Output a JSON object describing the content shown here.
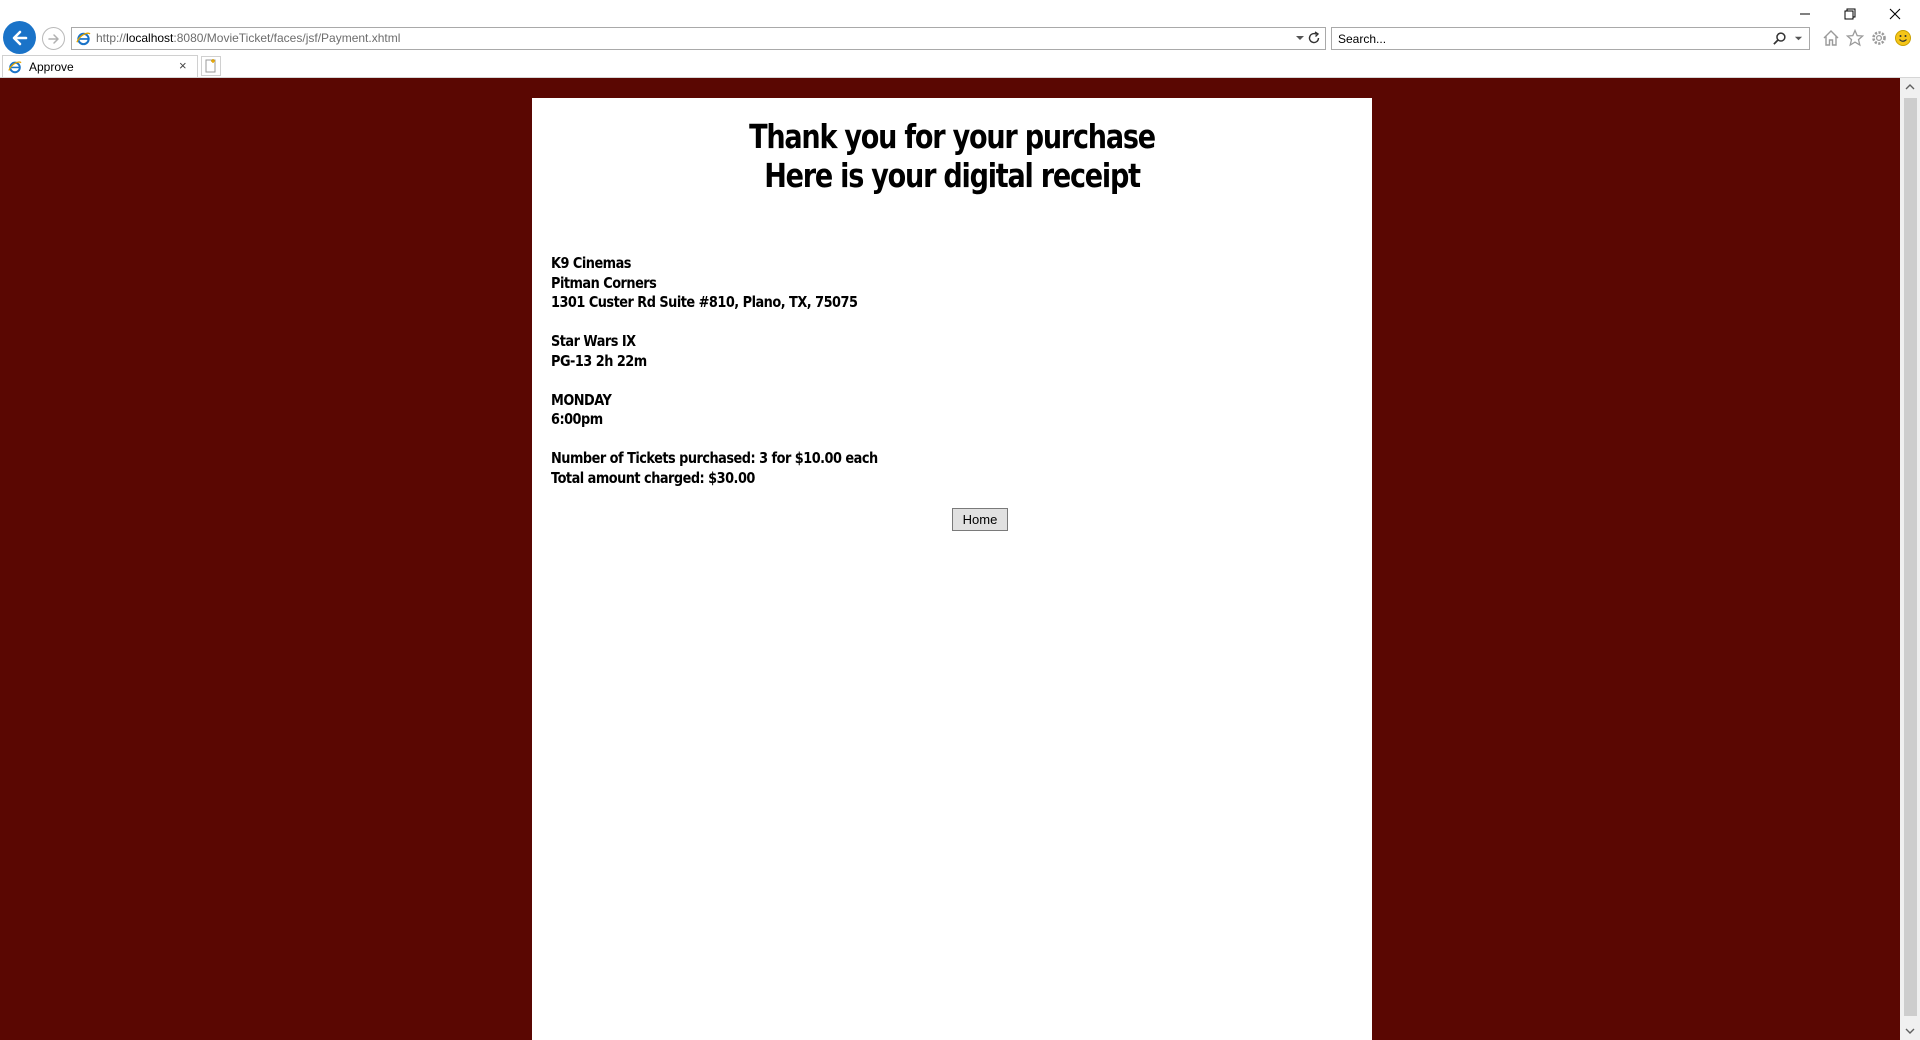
{
  "browser": {
    "url_prefix": "http://",
    "url_host": "localhost",
    "url_rest": ":8080/MovieTicket/faces/jsf/Payment.xhtml",
    "search_placeholder": "Search...",
    "tab_title": "Approve",
    "tab_close": "×",
    "icons": [
      "back-arrow-icon",
      "forward-arrow-icon",
      "ie-icon",
      "refresh-icon",
      "search-icon",
      "home-icon",
      "favorites-star-icon",
      "settings-gear-icon",
      "smiley-feedback-icon",
      "minimize-icon",
      "restore-icon",
      "close-icon"
    ]
  },
  "receipt": {
    "heading_line1": "Thank you for your purchase",
    "heading_line2": "Here is your digital receipt",
    "cinema_name": "K9 Cinemas",
    "cinema_location": "Pitman Corners",
    "cinema_address": "1301 Custer Rd Suite #810, Plano, TX, 75075",
    "movie_title": "Star Wars IX",
    "movie_info": "PG-13 2h 22m",
    "show_day": "MONDAY",
    "show_time": "6:00pm",
    "tickets_line": "Number of Tickets purchased: 3 for $10.00 each",
    "total_line": "Total amount charged: $30.00",
    "home_button": "Home"
  },
  "colors": {
    "page_background": "#5a0702",
    "card_background": "#ffffff",
    "accent_blue": "#1a73c8"
  }
}
